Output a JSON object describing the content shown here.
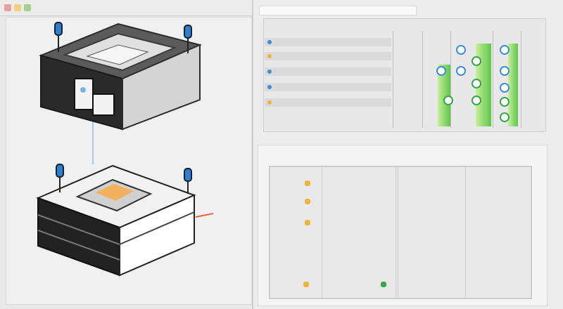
{
  "window": {
    "title": "",
    "accent": "#3c8fd6",
    "success": "#38a64b",
    "warning": "#f2b33d"
  },
  "ribbon": {
    "items": [
      "",
      "",
      "",
      ""
    ]
  },
  "model_view": {
    "upper_component": "housing-top",
    "lower_component": "housing-base",
    "leds": 4
  },
  "top_table": {
    "header": "",
    "rows": [
      {
        "label": "",
        "icon": "blue"
      },
      {
        "label": "",
        "icon": "orange"
      },
      {
        "label": "",
        "icon": "blue"
      },
      {
        "label": "",
        "icon": "blue"
      },
      {
        "label": "",
        "icon": "orange"
      }
    ],
    "status_icons": [
      "blue",
      "blue",
      "blue",
      "green",
      "blue",
      "blue",
      "green",
      "green",
      "blue",
      "green",
      "green",
      "green"
    ]
  },
  "bottom_grid": {
    "title": "",
    "cells": [
      {
        "text": "",
        "icon": "orange"
      },
      {
        "text": "",
        "icon": ""
      },
      {
        "text": "",
        "icon": ""
      },
      {
        "text": "",
        "icon": ""
      },
      {
        "text": "",
        "icon": ""
      },
      {
        "text": "",
        "icon": "green"
      }
    ]
  }
}
